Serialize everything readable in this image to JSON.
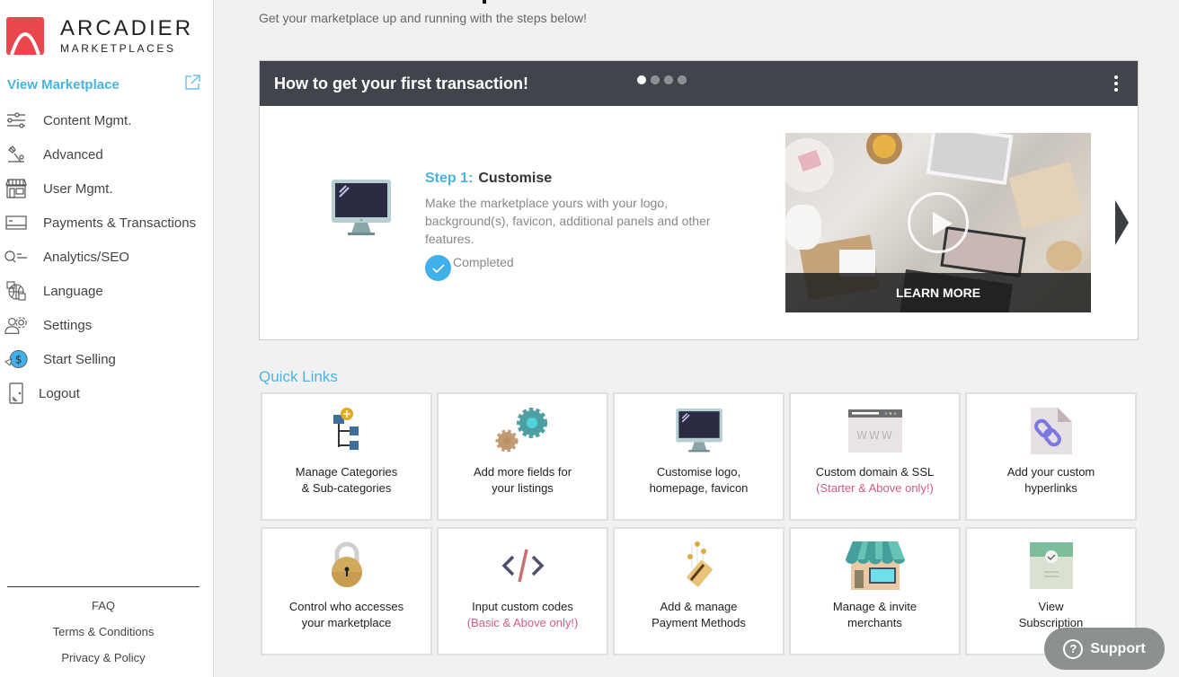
{
  "brand": {
    "name": "ARCADIER",
    "tagline": "MARKETPLACES",
    "color": "#e9474d"
  },
  "sidebar": {
    "view_marketplace": "View Marketplace",
    "items": [
      {
        "label": "Content Mgmt.",
        "icon": "sliders-icon"
      },
      {
        "label": "Advanced",
        "icon": "tools-icon"
      },
      {
        "label": "User Mgmt.",
        "icon": "storefront-icon"
      },
      {
        "label": "Payments & Transactions",
        "icon": "credit-card-icon"
      },
      {
        "label": "Analytics/SEO",
        "icon": "search-list-icon"
      },
      {
        "label": "Language",
        "icon": "globe-language-icon"
      },
      {
        "label": "Settings",
        "icon": "user-gear-icon"
      },
      {
        "label": "Start Selling",
        "icon": "dollar-circle-icon"
      },
      {
        "label": "Logout",
        "icon": "door-icon"
      }
    ],
    "footer": [
      "FAQ",
      "Terms & Conditions",
      "Privacy & Policy"
    ]
  },
  "main": {
    "subtitle": "Get your marketplace up and running with the steps below!",
    "carousel": {
      "title": "How to get your first transaction!",
      "slides_total": 4,
      "active_slide": 1,
      "step_number": "Step 1:",
      "step_title": "Customise",
      "step_description": "Make the marketplace yours with your logo, background(s), favicon, additional panels and other features.",
      "status": "Completed",
      "video_cta": "LEARN MORE"
    },
    "quick_links_title": "Quick Links",
    "quick_links": [
      {
        "line1": "Manage Categories",
        "line2": "& Sub-categories",
        "note": "",
        "icon": "category-tree-icon"
      },
      {
        "line1": "Add more fields for",
        "line2": "your listings",
        "note": "",
        "icon": "gears-icon"
      },
      {
        "line1": "Customise logo,",
        "line2": "homepage, favicon",
        "note": "",
        "icon": "monitor-icon"
      },
      {
        "line1": "Custom domain & SSL",
        "line2": "",
        "note": "(Starter & Above only!)",
        "icon": "www-browser-icon"
      },
      {
        "line1": "Add your custom",
        "line2": "hyperlinks",
        "note": "",
        "icon": "link-document-icon"
      },
      {
        "line1": "Control who accesses",
        "line2": "your marketplace",
        "note": "",
        "icon": "padlock-icon"
      },
      {
        "line1": "Input custom codes",
        "line2": "",
        "note": "(Basic & Above only!)",
        "icon": "code-icon"
      },
      {
        "line1": "Add & manage",
        "line2": "Payment Methods",
        "note": "",
        "icon": "payment-card-icon"
      },
      {
        "line1": "Manage & invite",
        "line2": "merchants",
        "note": "",
        "icon": "shop-awning-icon"
      },
      {
        "line1": "View",
        "line2": "Subscription",
        "note": "",
        "icon": "subscription-doc-icon"
      }
    ]
  },
  "support": {
    "label": "Support"
  },
  "colors": {
    "accent": "#4ab3e2",
    "note": "#d05b8a",
    "header": "#41454b"
  }
}
